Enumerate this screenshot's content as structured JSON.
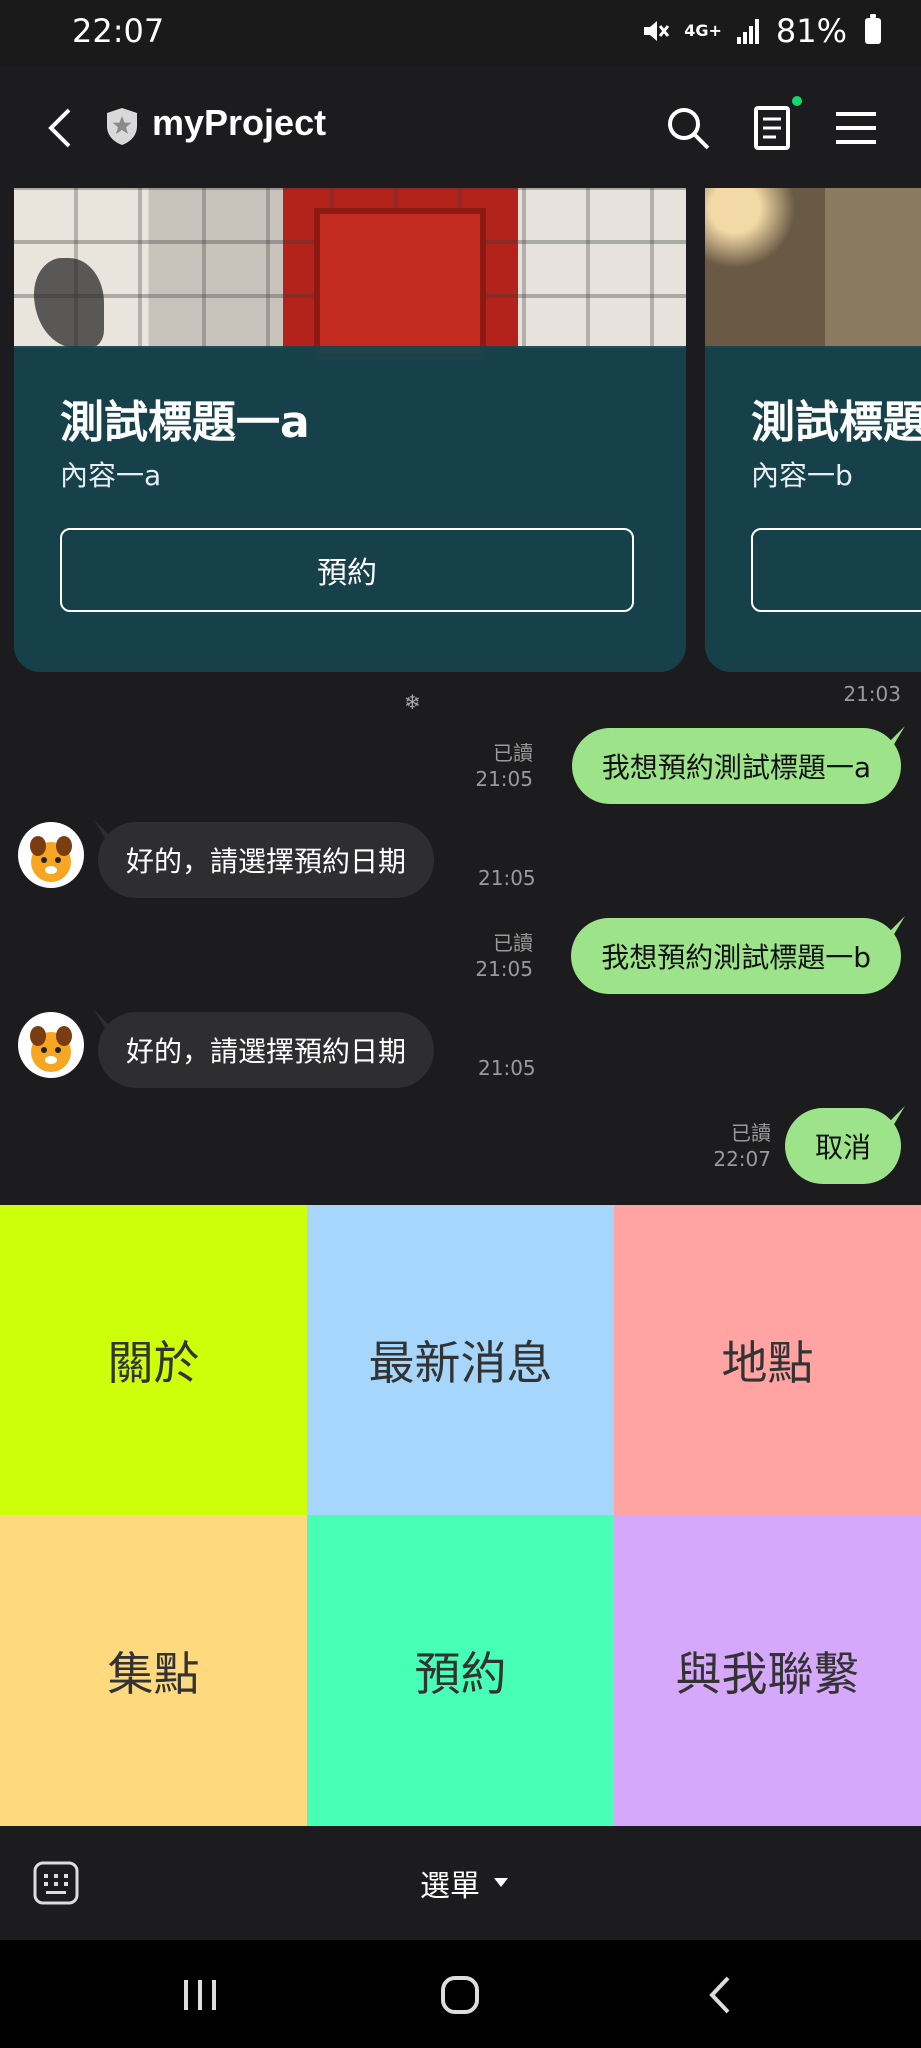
{
  "status_bar": {
    "time": "22:07",
    "network": "4G+",
    "battery": "81%"
  },
  "header": {
    "title": "myProject"
  },
  "carousel": {
    "cards": [
      {
        "title": "測試標題一a",
        "content": "內容一a",
        "button": "預約"
      },
      {
        "title": "測試標題一b",
        "content": "內容一b",
        "button": "預約"
      }
    ],
    "time": "21:03"
  },
  "messages": [
    {
      "direction": "out",
      "text": "我想預約測試標題一a",
      "read": "已讀",
      "time": "21:05"
    },
    {
      "direction": "in",
      "text": "好的，請選擇預約日期",
      "time": "21:05"
    },
    {
      "direction": "out",
      "text": "我想預約測試標題一b",
      "read": "已讀",
      "time": "21:05"
    },
    {
      "direction": "in",
      "text": "好的，請選擇預約日期",
      "time": "21:05"
    },
    {
      "direction": "out",
      "text": "取消",
      "read": "已讀",
      "time": "22:07"
    }
  ],
  "rich_menu": {
    "items": [
      {
        "label": "關於",
        "color": "#cdff0a"
      },
      {
        "label": "最新消息",
        "color": "#a6d6fc"
      },
      {
        "label": "地點",
        "color": "#ffa3a3"
      },
      {
        "label": "集點",
        "color": "#ffd97d"
      },
      {
        "label": "預約",
        "color": "#47ffb5"
      },
      {
        "label": "與我聯繫",
        "color": "#d5a8fc"
      }
    ]
  },
  "input_bar": {
    "menu_label": "選單"
  },
  "icons": [
    "back-icon",
    "shield-icon",
    "search-icon",
    "notes-icon",
    "hamburger-icon",
    "keyboard-icon",
    "recent-apps-icon",
    "home-icon",
    "nav-back-icon"
  ]
}
